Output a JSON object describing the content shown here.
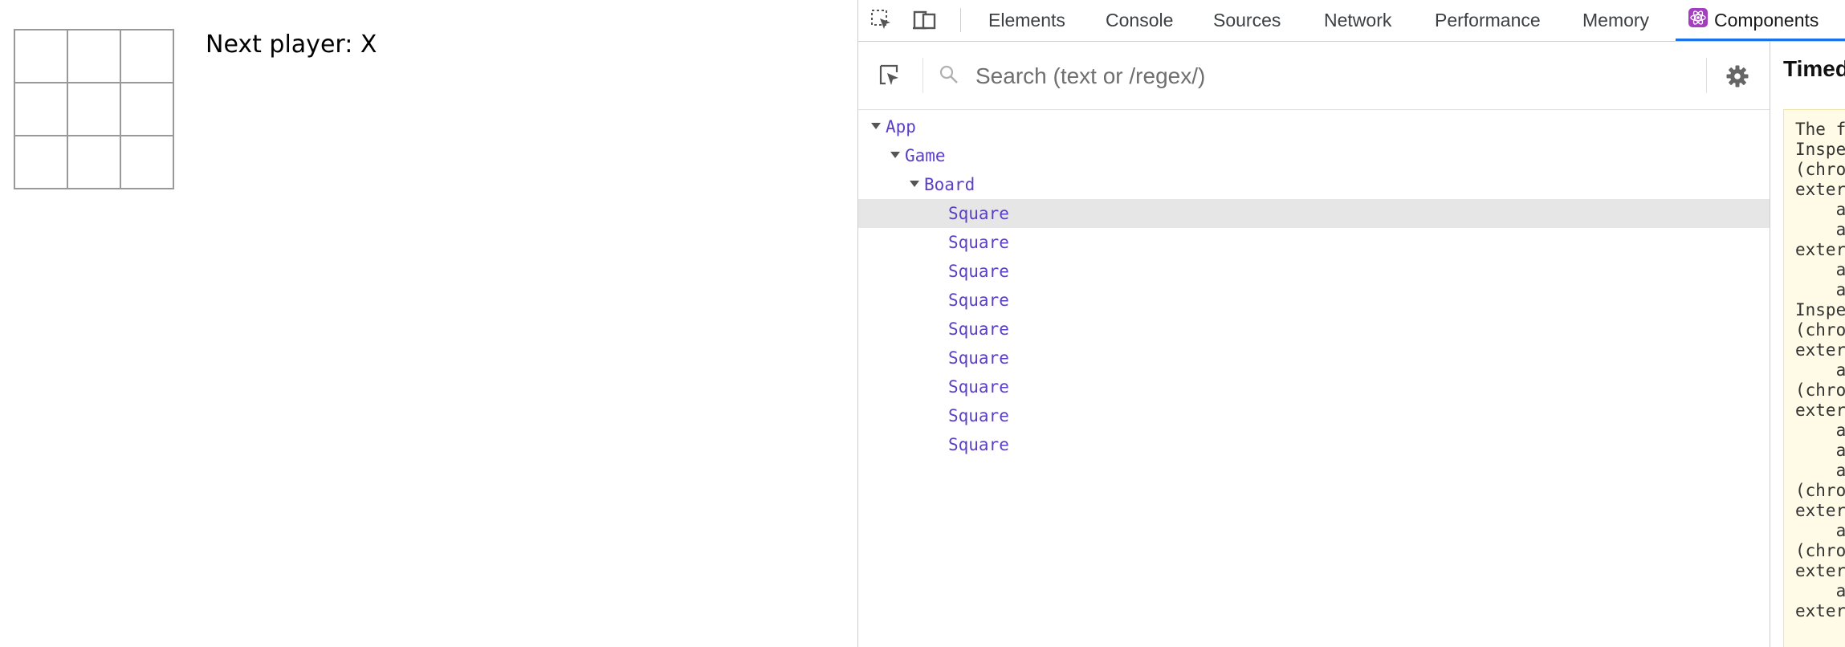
{
  "app": {
    "status": "Next player: X",
    "squares": [
      "",
      "",
      "",
      "",
      "",
      "",
      "",
      "",
      ""
    ]
  },
  "devtools": {
    "tabs": [
      "Elements",
      "Console",
      "Sources",
      "Network",
      "Performance",
      "Memory",
      "Components"
    ],
    "active_tab": "Components",
    "search": {
      "placeholder": "Search (text or /regex/)",
      "value": ""
    },
    "tree": [
      {
        "label": "App",
        "depth": 0,
        "expanded": true
      },
      {
        "label": "Game",
        "depth": 1,
        "expanded": true
      },
      {
        "label": "Board",
        "depth": 2,
        "expanded": true
      },
      {
        "label": "Square",
        "depth": 3,
        "selected": true
      },
      {
        "label": "Square",
        "depth": 3
      },
      {
        "label": "Square",
        "depth": 3
      },
      {
        "label": "Square",
        "depth": 3
      },
      {
        "label": "Square",
        "depth": 3
      },
      {
        "label": "Square",
        "depth": 3
      },
      {
        "label": "Square",
        "depth": 3
      },
      {
        "label": "Square",
        "depth": 3
      },
      {
        "label": "Square",
        "depth": 3
      }
    ],
    "side_panel": {
      "title": "Timed",
      "lines": [
        "The f",
        "Inspe",
        "(chro",
        "exter",
        "    a",
        "    a",
        "exter",
        "    a",
        "    a",
        "Inspe",
        "(chro",
        "exter",
        "    a",
        "(chro",
        "exter",
        "    a",
        "    a",
        "    a",
        "(chro",
        "exter",
        "    a",
        "(chro",
        "exter",
        "    a",
        "exter"
      ]
    }
  },
  "colors": {
    "tree_text": "#5b3fc4",
    "active_tab_underline": "#1a73e8",
    "side_box_bg": "#fffbe6"
  },
  "icons": [
    "inspect-element-icon",
    "device-toolbar-icon",
    "react-logo-icon",
    "select-component-icon",
    "search-icon",
    "gear-icon",
    "expand-arrow-icon"
  ]
}
